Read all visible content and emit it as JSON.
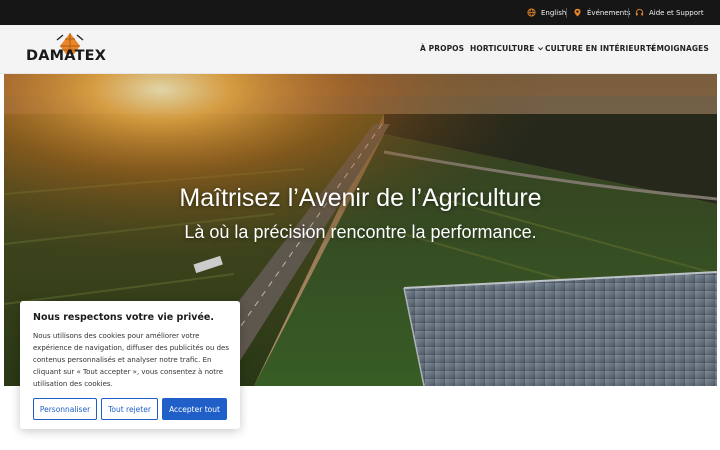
{
  "topbar": {
    "language": "English",
    "events": "Événements",
    "support": "Aide et Support"
  },
  "logo": {
    "text": "DAMATEX"
  },
  "nav": {
    "about": "À PROPOS",
    "horticulture": "HORTICULTURE",
    "indoor": "CULTURE EN INTÉRIEUR",
    "testimonials": "TÉMOIGNAGES"
  },
  "hero": {
    "title": "Maîtrisez l’Avenir de l’Agriculture",
    "subtitle": "Là où la précision rencontre la performance."
  },
  "cookie": {
    "title": "Nous respectons votre vie privée.",
    "body": "Nous utilisons des cookies pour améliorer votre expérience de navigation, diffuser des publicités ou des contenus personnalisés et analyser notre trafic. En cliquant sur « Tout accepter », vous consentez à notre utilisation des cookies.",
    "customize": "Personnaliser",
    "reject": "Tout rejeter",
    "accept": "Accepter tout"
  },
  "colors": {
    "topbar_bg": "#161616",
    "nav_bg": "#f4f4f4",
    "accent_orange": "#e8862a",
    "button_blue": "#1f5fc7"
  },
  "icons": {
    "language": "globe-icon",
    "events": "location-pin-icon",
    "support": "headset-icon",
    "dropdown": "chevron-down-icon"
  }
}
